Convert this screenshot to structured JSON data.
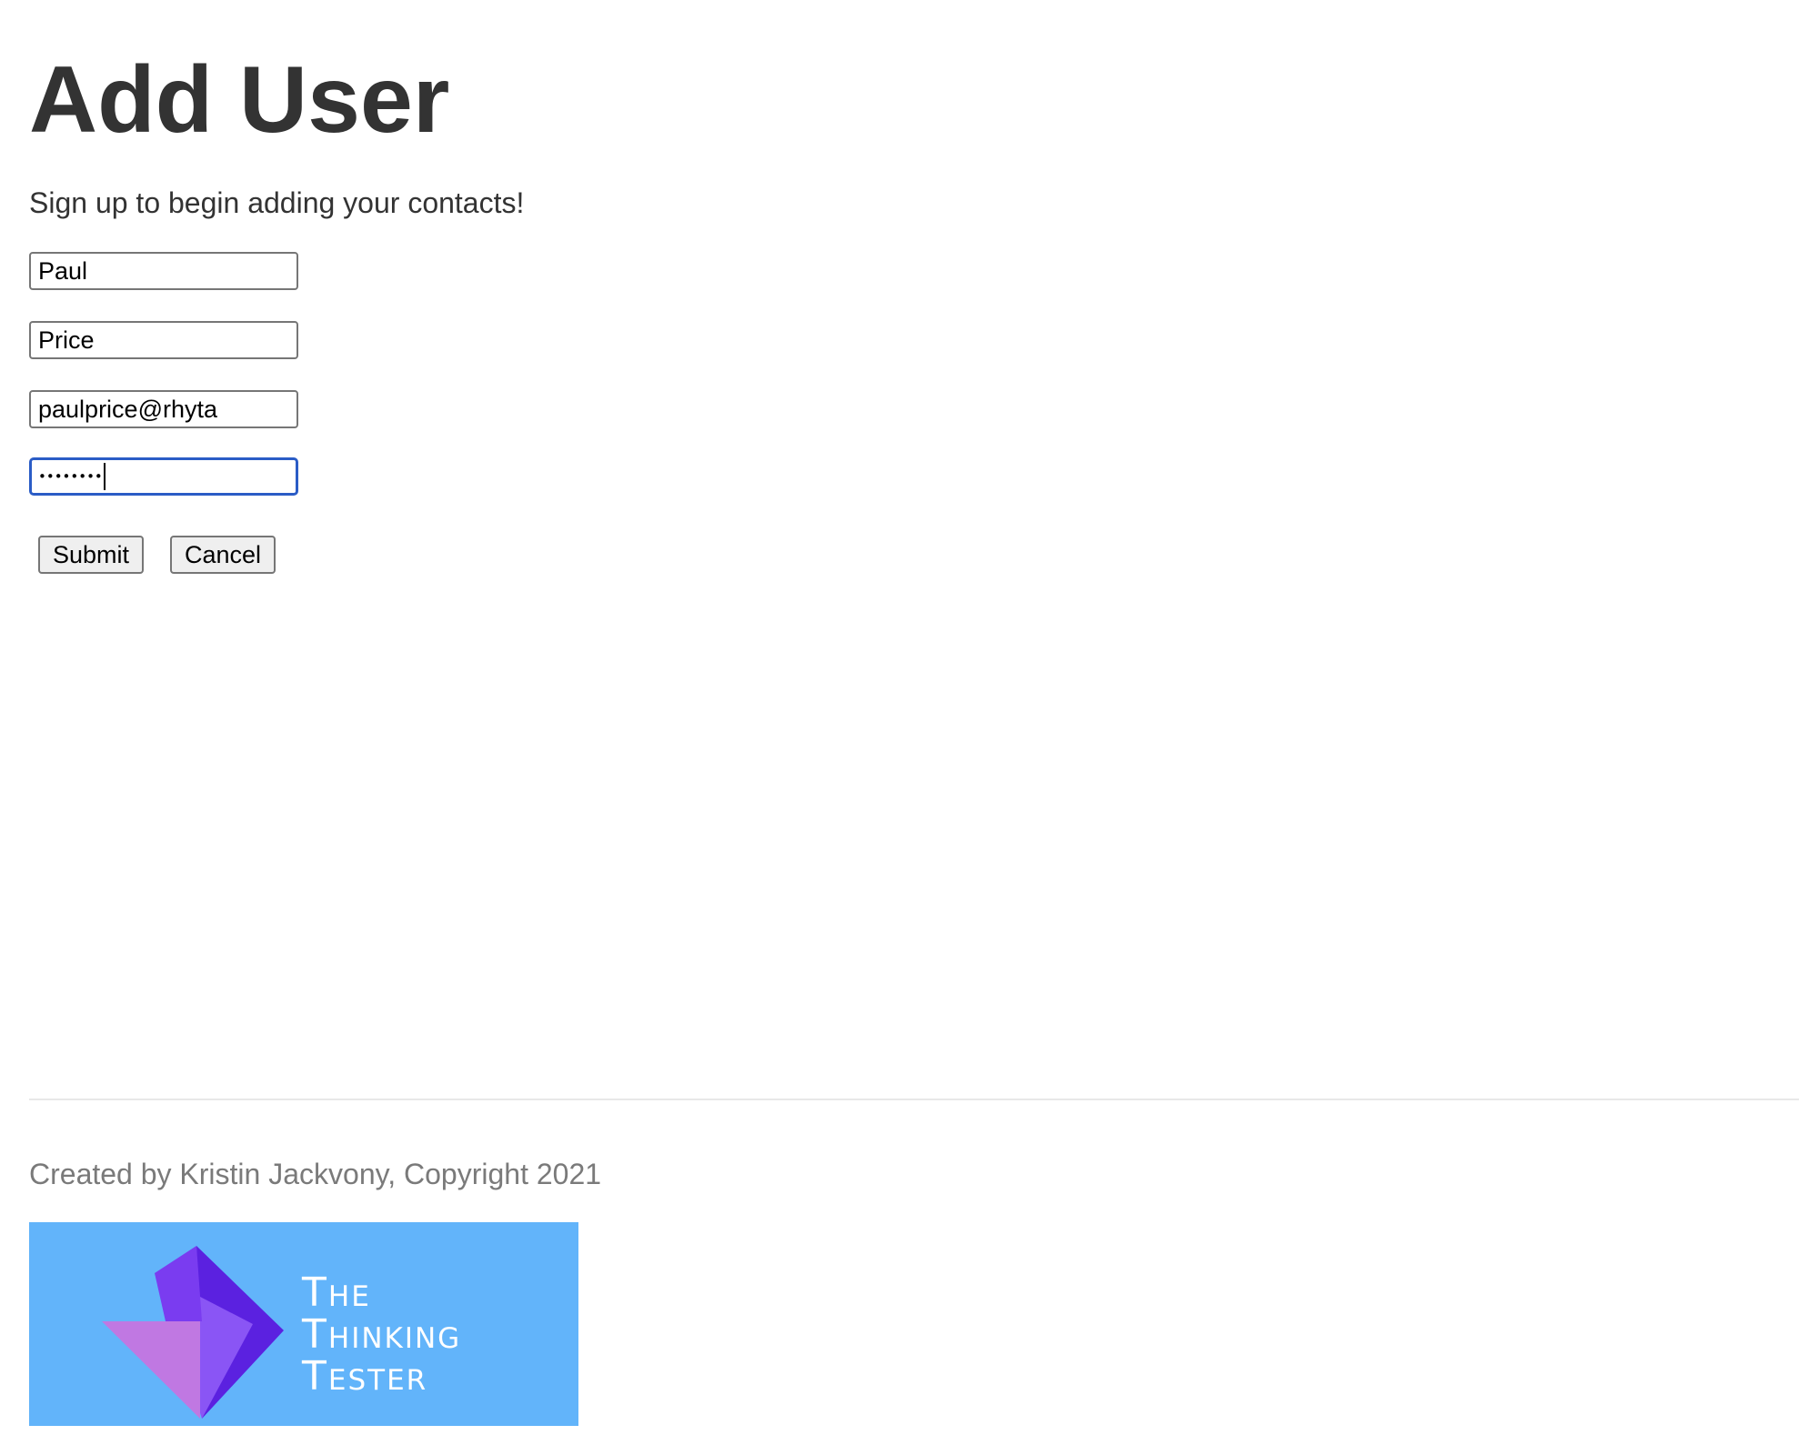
{
  "header": {
    "title": "Add User",
    "subtitle": "Sign up to begin adding your contacts!"
  },
  "form": {
    "first_name_value": "Paul",
    "last_name_value": "Price",
    "email_value": "paulprice@rhyta",
    "password_masked": "••••••••",
    "submit_label": "Submit",
    "cancel_label": "Cancel"
  },
  "footer": {
    "credit": "Created by Kristin Jackvony, Copyright 2021",
    "logo": {
      "icon": "origami-bird-icon",
      "lines": [
        "The",
        "Thinking",
        "Tester"
      ],
      "background_color": "#62b4fa",
      "accent_colors": [
        "#5b21e0",
        "#8a55f5",
        "#c078e2"
      ]
    }
  },
  "colors": {
    "focus_border": "#2a5cc6",
    "heading_text": "#333333",
    "footer_text": "#7a7a7a"
  }
}
